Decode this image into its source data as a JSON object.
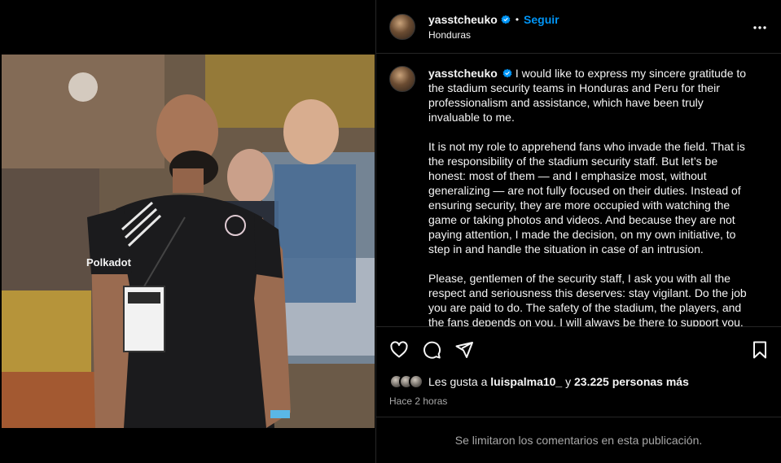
{
  "post": {
    "username": "yasstcheuko",
    "follow_label": "Seguir",
    "separator": "•",
    "location": "Honduras",
    "more_icon": "more-horizontal-icon",
    "caption_paragraphs": [
      "I would like to express my sincere gratitude to the stadium security teams in Honduras and Peru for their professionalism and assistance, which have been truly invaluable to me.",
      "It is not my role to apprehend fans who invade the field. That is the responsibility of the stadium security staff. But let’s be honest: most of them — and I emphasize most, without generalizing — are not fully focused on their duties. Instead of ensuring security, they are more occupied with watching the game or taking photos and videos. And because they are not paying attention, I made the decision, on my own initiative, to step in and handle the situation in case of an intrusion.",
      "Please, gentlemen of the security staff, I ask you with all the respect and seriousness this deserves: stay vigilant. Do the job you are paid to do. The safety of the stadium, the players, and the fans depends on you. I will always be there to support you,"
    ],
    "likes_prefix": "Les gusta a",
    "likes_user": "luispalma10_",
    "likes_middle": "y",
    "likes_count": "23.225 personas más",
    "time_ago": "Hace 2 horas",
    "comments_notice": "Se limitaron los comentarios en esta publicación.",
    "photo_logo_text": "Polkadot"
  },
  "colors": {
    "accent": "#0095f6",
    "background": "#000000",
    "muted": "#a8a8a8",
    "divider": "#262626"
  }
}
